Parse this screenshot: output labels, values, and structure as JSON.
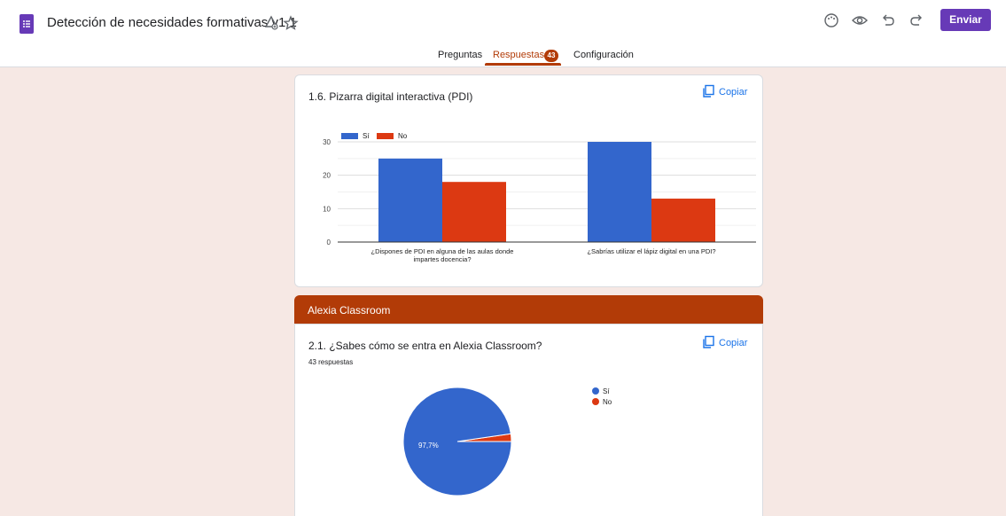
{
  "header": {
    "title": "Detección de necesidades formativas v1.1",
    "send_label": "Enviar",
    "icons": [
      "forms-logo-icon",
      "move-to-folder-icon",
      "star-icon",
      "palette-icon",
      "preview-eye-icon",
      "undo-icon",
      "redo-icon"
    ]
  },
  "tabs": {
    "questions": "Preguntas",
    "responses": "Respuestas",
    "responses_count": "43",
    "settings": "Configuración"
  },
  "colors": {
    "accent": "#b23b07",
    "brand": "#673ab7",
    "series_si": "#3366cc",
    "series_no": "#dc3912",
    "background": "#f6e8e4"
  },
  "card1": {
    "question": "1.6. Pizarra digital interactiva (PDI)",
    "copy_label": "Copiar"
  },
  "section": {
    "title": "Alexia Classroom"
  },
  "card2": {
    "question": "2.1. ¿Sabes cómo se entra en Alexia Classroom?",
    "responses": "43 respuestas",
    "copy_label": "Copiar"
  },
  "chart_data": [
    {
      "type": "bar",
      "categories": [
        "¿Dispones de PDI en alguna de las aulas donde impartes docencia?",
        "¿Sabrías utilizar el lápiz digital en una PDI?"
      ],
      "series": [
        {
          "name": "Sí",
          "color": "#3366cc",
          "values": [
            25,
            30
          ]
        },
        {
          "name": "No",
          "color": "#dc3912",
          "values": [
            18,
            13
          ]
        }
      ],
      "ylim": [
        0,
        30
      ],
      "yticks": [
        0,
        10,
        20,
        30
      ],
      "grid": true,
      "legend": "top-left"
    },
    {
      "type": "pie",
      "labels": [
        "Sí",
        "No"
      ],
      "colors": [
        "#3366cc",
        "#dc3912"
      ],
      "values": [
        97.7,
        2.3
      ],
      "slice_label": "97,7%",
      "legend": "right"
    }
  ]
}
